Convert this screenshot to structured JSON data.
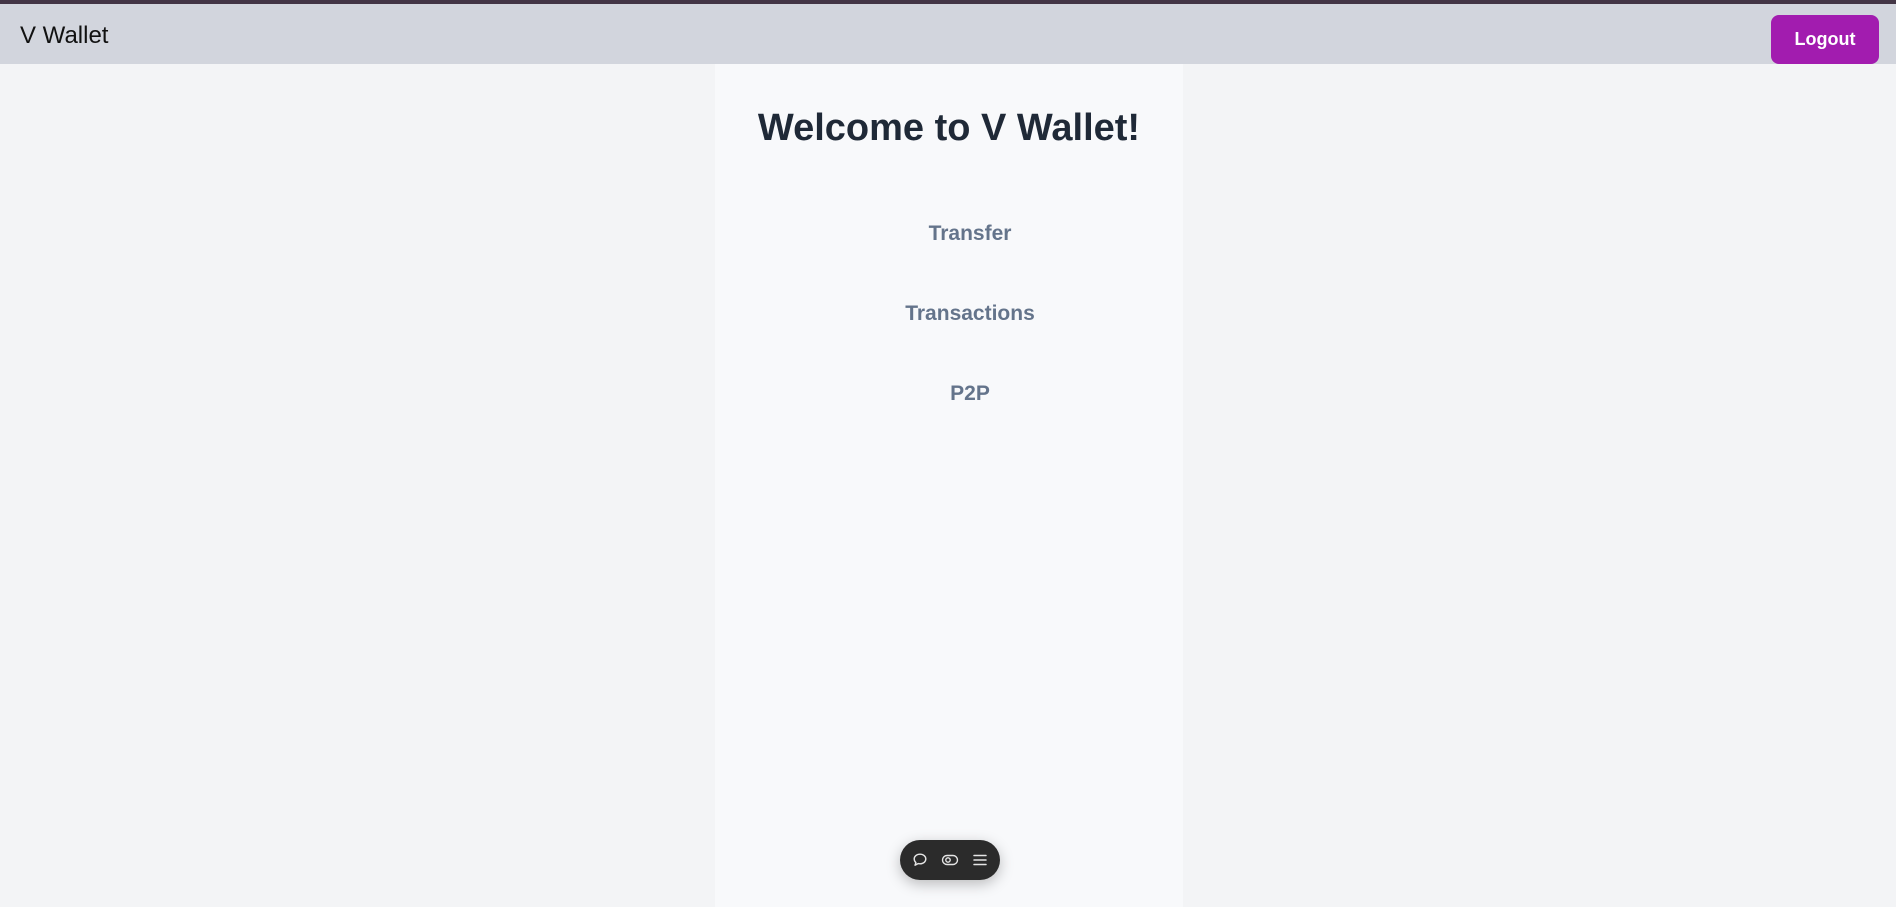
{
  "app": {
    "brand": "V Wallet"
  },
  "header": {
    "logout_label": "Logout"
  },
  "main": {
    "title": "Welcome to V Wallet!",
    "links": [
      {
        "label": "Transfer"
      },
      {
        "label": "Transactions"
      },
      {
        "label": "P2P"
      }
    ]
  },
  "toolbar": {
    "icons": [
      "chat-bubble-icon",
      "eye-toggle-icon",
      "menu-icon"
    ]
  },
  "colors": {
    "accent": "#a21caf",
    "navbar": "#d2d5dd",
    "top_strip": "#433545",
    "link_text": "#64748b",
    "title_text": "#1f2937"
  }
}
